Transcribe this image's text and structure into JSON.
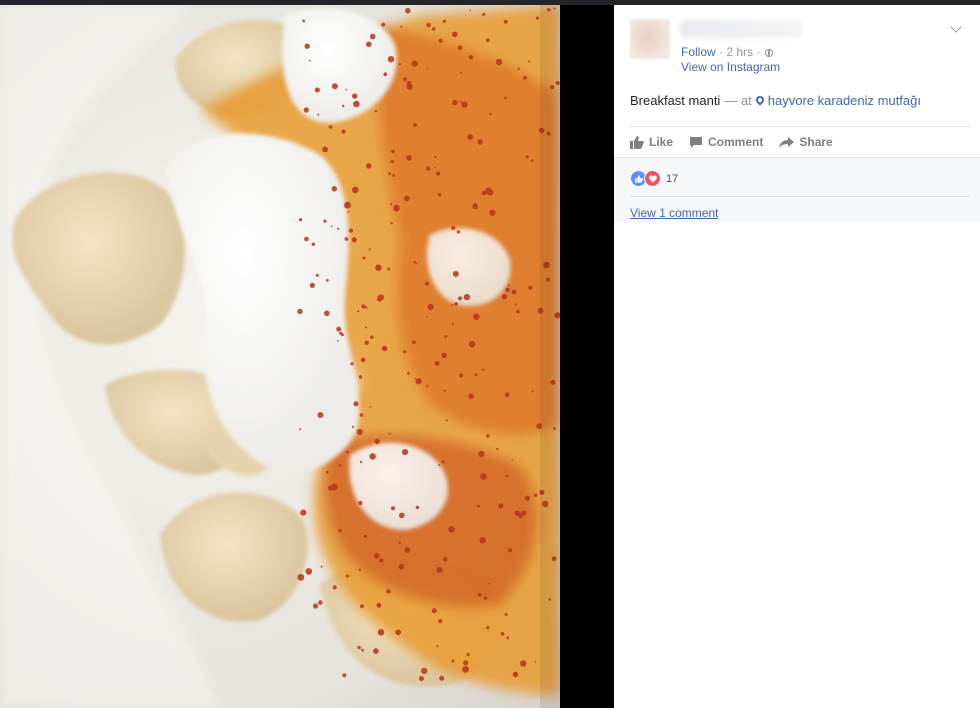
{
  "post": {
    "author": "",
    "follow": "Follow",
    "time": "2 hrs",
    "dot": "·",
    "via": "View on Instagram",
    "text": "Breakfast manti",
    "at_sep": "— at",
    "location": "hayvore karadeniz mutfağı"
  },
  "actions": {
    "like": "Like",
    "comment": "Comment",
    "share": "Share"
  },
  "feedback": {
    "reaction_count": "17",
    "view_comments": "View 1 comment"
  },
  "colors": {
    "link": "#4267b2",
    "like_reaction": "#5890ff",
    "love_reaction": "#f25268",
    "background": "#000000"
  },
  "icons": [
    "chevron-down-icon",
    "globe-icon",
    "map-pin-icon",
    "like-icon",
    "comment-icon",
    "share-icon",
    "like-reaction-icon",
    "love-reaction-icon"
  ]
}
